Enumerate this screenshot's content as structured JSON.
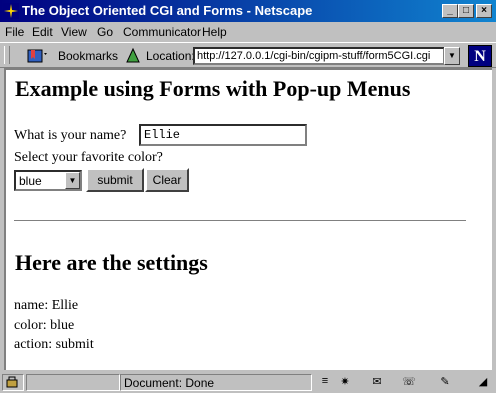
{
  "window": {
    "title": "The Object Oriented CGI and Forms - Netscape"
  },
  "menubar": {
    "file": "File",
    "edit": "Edit",
    "view": "View",
    "go": "Go",
    "communicator": "Communicator",
    "help": "Help"
  },
  "toolbar": {
    "bookmarks_label": "Bookmarks",
    "location_label": "Location:",
    "url": "http://127.0.0.1/cgi-bin/cgipm-stuff/form5CGI.cgi"
  },
  "page": {
    "heading": "Example using Forms with Pop-up Menus",
    "name_prompt": "What is your name?",
    "name_value": "Ellie",
    "color_prompt": "Select your favorite color?",
    "color_selected": "blue",
    "submit_label": "submit",
    "clear_label": "Clear",
    "settings_heading": "Here are the settings",
    "result_name": "name: Ellie",
    "result_color": "color: blue",
    "result_action": "action: submit"
  },
  "statusbar": {
    "text": "Document: Done"
  },
  "colors": {
    "titlebar": "#000080",
    "chrome": "#c0c0c0",
    "content_bg": "#ffffff"
  }
}
